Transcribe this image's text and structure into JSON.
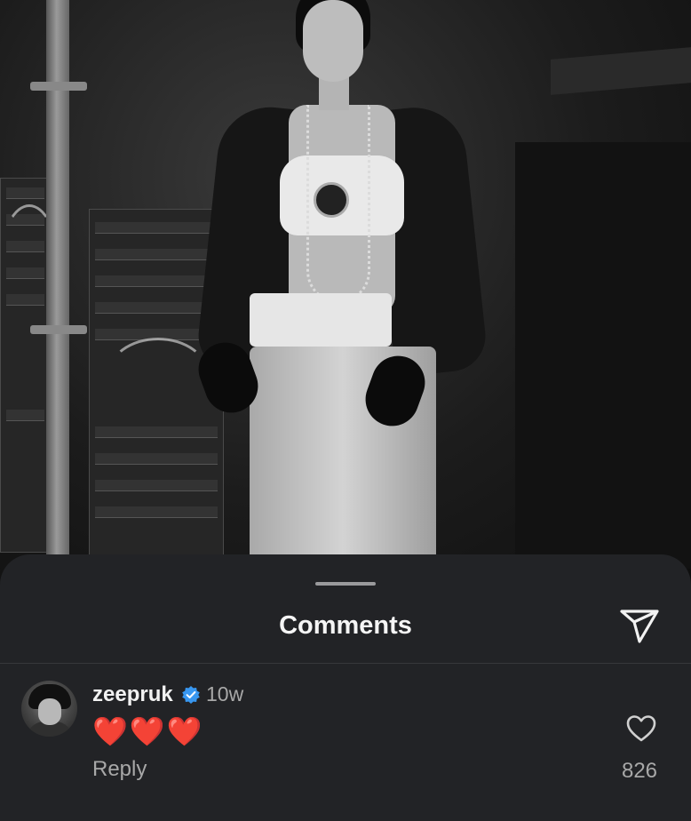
{
  "post": {
    "image_description_icon": "photo"
  },
  "sheet": {
    "title": "Comments",
    "share_icon": "share-send-icon"
  },
  "comments": [
    {
      "username": "zeepruk",
      "verified": true,
      "time": "10w",
      "text": "❤️❤️❤️",
      "reply_label": "Reply",
      "likes": "826"
    }
  ],
  "colors": {
    "sheet_bg": "#222326",
    "verified_blue": "#3897f0",
    "secondary_text": "#a8a8a8",
    "heart_red": "#e53935"
  }
}
